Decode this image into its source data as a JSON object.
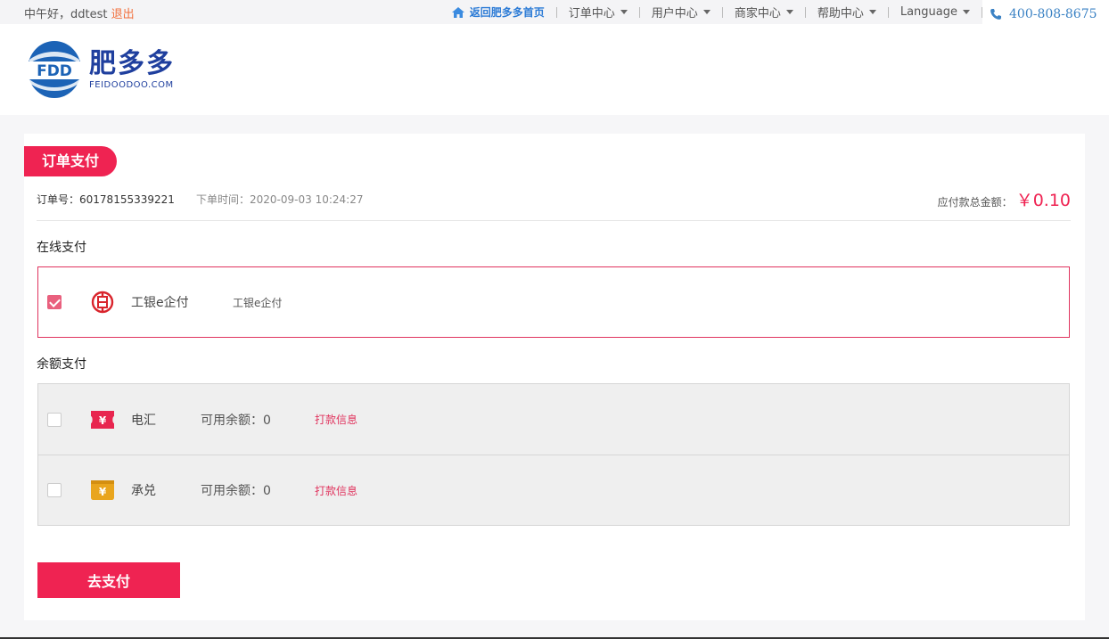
{
  "topbar": {
    "greeting": "中午好，ddtest",
    "logout": "退出",
    "home_link": "返回肥多多首页",
    "nav": [
      "订单中心",
      "用户中心",
      "商家中心",
      "帮助中心",
      "Language"
    ],
    "phone": "400-808-8675"
  },
  "header": {
    "logo_badge": "FDD",
    "logo_cn": "肥多多",
    "logo_en": "FEIDOODOO.COM"
  },
  "order": {
    "section_title": "订单支付",
    "order_no_label": "订单号：",
    "order_no": "60178155339221",
    "order_time_label": "下单时间：",
    "order_time": "2020-09-03 10:24:27",
    "total_label": "应付款总金额：",
    "total_amount": "￥0.10"
  },
  "online_payment": {
    "title": "在线支付",
    "method": {
      "name": "工银e企付",
      "description": "工银e企付",
      "checked": true,
      "icon": "icbc-icon"
    }
  },
  "balance_payment": {
    "title": "余额支付",
    "methods": [
      {
        "name": "电汇",
        "balance_label": "可用余额：",
        "balance": "0",
        "link": "打款信息",
        "checked": false,
        "icon": "wire-transfer-icon"
      },
      {
        "name": "承兑",
        "balance_label": "可用余额：",
        "balance": "0",
        "link": "打款信息",
        "checked": false,
        "icon": "acceptance-icon"
      }
    ]
  },
  "submit_label": "去支付",
  "colors": {
    "accent": "#ef2352",
    "link_blue": "#2c7bd6",
    "logo_blue": "#1f3f9e",
    "logout_orange": "#f2713e"
  }
}
